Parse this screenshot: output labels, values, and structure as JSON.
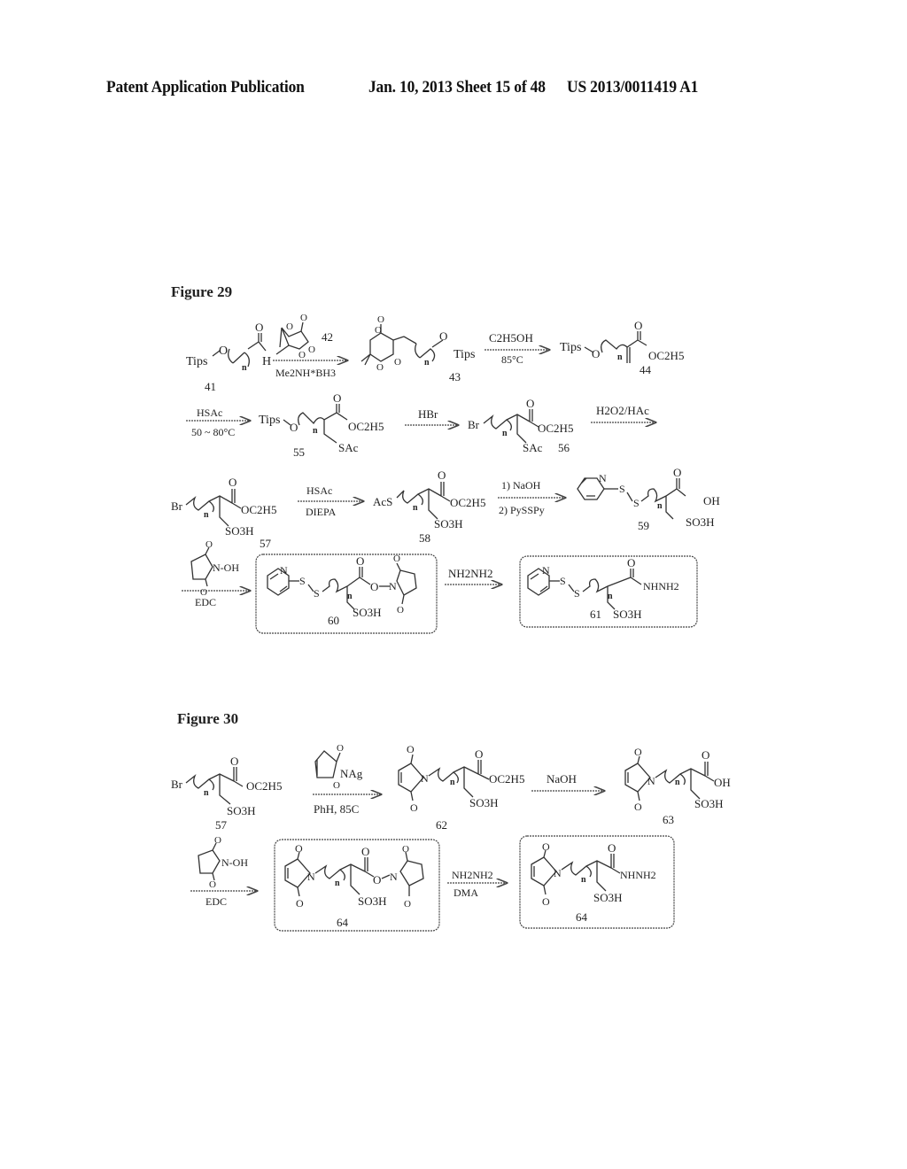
{
  "header": {
    "left": "Patent Application Publication",
    "middle": "Jan. 10, 2013  Sheet 15 of 48",
    "right": "US 2013/0011419 A1"
  },
  "figure29": {
    "title": "Figure 29",
    "compounds": {
      "c41": {
        "label": "41",
        "left_group": "Tips",
        "o": "O",
        "n": "n",
        "carbonyl_o": "O",
        "h": "H"
      },
      "c42": {
        "label": "42"
      },
      "c43": {
        "label": "43",
        "right_group": "Tips",
        "o": "O",
        "n": "n"
      },
      "c44": {
        "label": "44",
        "left_group": "Tips",
        "o": "O",
        "n": "n",
        "ester": "OC2H5"
      },
      "c55": {
        "label": "55",
        "left_group": "Tips",
        "o": "O",
        "n": "n",
        "ester": "OC2H5",
        "side": "SAc"
      },
      "c56": {
        "label": "56",
        "left_group": "Br",
        "n": "n",
        "ester": "OC2H5",
        "side": "SAc"
      },
      "c57": {
        "label": "57",
        "left_group": "Br",
        "n": "n",
        "ester": "OC2H5",
        "side": "SO3H"
      },
      "c58": {
        "label": "58",
        "left_group": "AcS",
        "n": "n",
        "ester": "OC2H5",
        "side": "SO3H"
      },
      "c59": {
        "label": "59",
        "n_atom": "N",
        "s": "S",
        "n": "n",
        "acid": "OH",
        "side": "SO3H"
      },
      "c60": {
        "label": "60",
        "n_atom": "N",
        "s": "S",
        "n": "n",
        "side": "SO3H"
      },
      "c61": {
        "label": "61",
        "n_atom": "N",
        "s": "S",
        "n": "n",
        "hydrazide": "NHNH2",
        "side": "SO3H"
      }
    },
    "arrows": {
      "a1_below": "Me2NH*BH3",
      "a2_above": "C2H5OH",
      "a2_below": "85°C",
      "a3_above": "HSAc",
      "a3_below": "50 ~ 80°C",
      "a4_above": "HBr",
      "a5_above": "H2O2/HAc",
      "a6_above": "HSAc",
      "a6_below": "DIEPA",
      "a7_above": "1) NaOH",
      "a7_below": "2) PySSPy",
      "a8_reagent": "N-OH",
      "a8_below": "EDC",
      "a9_above": "NH2NH2"
    }
  },
  "figure30": {
    "title": "Figure 30",
    "compounds": {
      "c57": {
        "label": "57",
        "left_group": "Br",
        "n": "n",
        "ester": "OC2H5",
        "side": "SO3H"
      },
      "c62": {
        "label": "62",
        "n": "n",
        "ester": "OC2H5",
        "side": "SO3H"
      },
      "c63": {
        "label": "63",
        "n": "n",
        "acid": "OH",
        "side": "SO3H"
      },
      "c64a": {
        "label": "64",
        "n": "n",
        "side": "SO3H"
      },
      "c64b": {
        "label": "64",
        "n": "n",
        "hydrazide": "NHNH2",
        "side": "SO3H"
      }
    },
    "arrows": {
      "b1_reagent": "NAg",
      "b1_below": "PhH, 85C",
      "b2_above": "NaOH",
      "b3_reagent": "N-OH",
      "b3_below": "EDC",
      "b4_above": "NH2NH2",
      "b4_below": "DMA"
    }
  }
}
